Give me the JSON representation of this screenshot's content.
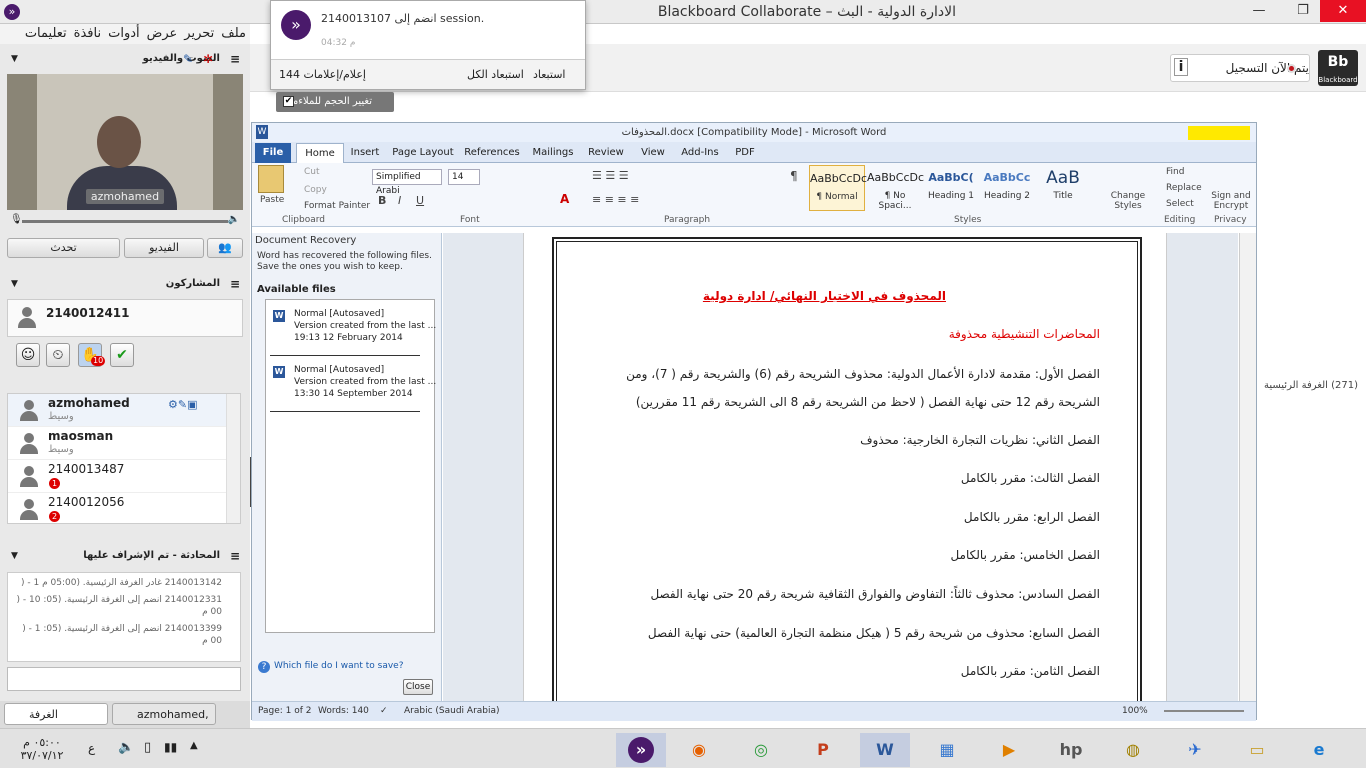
{
  "window": {
    "title": "Blackboard Collaborate – الادارة الدولية - البث",
    "icon": "bb-app-icon"
  },
  "menu": [
    "ملف",
    "تحرير",
    "عرض",
    "أدوات",
    "نافذة",
    "تعليمات"
  ],
  "collab": {
    "recording_label": "يتم الآن التسجيل",
    "logo_text": "Bb",
    "logo_sub": "Blackboard"
  },
  "notification": {
    "message": "2140013107 انضم إلى session.",
    "time": "04:32 م",
    "count_label": "144 إعلام/إعلامات",
    "dismiss_all": "استبعاد الكل",
    "dismiss": "استبعاد",
    "resize_option": "تغيير الحجم للملاءمة"
  },
  "left": {
    "av_title": "الصوت والفيديو",
    "video_name": "azmohamed",
    "talk_btn": "تحدث",
    "video_btn": "الفيديو",
    "participants_title": "المشاركون",
    "self_name": "2140012411",
    "raise_count": "10",
    "room_label": "(271) الغرفة الرئيسية",
    "participants": [
      {
        "name": "azmohamed",
        "role": "وسيط",
        "badge": ""
      },
      {
        "name": "maosman",
        "role": "وسيط",
        "badge": ""
      },
      {
        "name": "2140013487",
        "role": "",
        "badge": "1"
      },
      {
        "name": "2140012056",
        "role": "",
        "badge": "2"
      }
    ],
    "chat_title": "المحادثة - تم الإشراف عليها",
    "chat_lines": [
      "2140013142 غادر الغرفة الرئيسية. (05:00 م 1 - ( ",
      "2140012331 انضم إلى الغرفة الرئيسية. (05: 10 - ( 00 م",
      "2140013399 انضم إلى الغرفة الرئيسية. (05: 1 - ( 00 م"
    ],
    "tab_room": "الغرفة",
    "tab_user": "azmohamed, ..."
  },
  "word": {
    "title": "المحذوفات.docx [Compatibility Mode] - Microsoft Word",
    "tabs": [
      "File",
      "Home",
      "Insert",
      "Page Layout",
      "References",
      "Mailings",
      "Review",
      "View",
      "Add-Ins",
      "PDF"
    ],
    "clipboard": {
      "paste": "Paste",
      "cut": "Cut",
      "copy": "Copy",
      "format_painter": "Format Painter",
      "label": "Clipboard"
    },
    "font": {
      "name": "Simplified Arabi",
      "size": "14",
      "label": "Font"
    },
    "paragraph_label": "Paragraph",
    "styles": [
      {
        "sample": "AaBbCcDc",
        "name": "¶ Normal"
      },
      {
        "sample": "AaBbCcDc",
        "name": "¶ No Spaci..."
      },
      {
        "sample": "AaBbC(",
        "name": "Heading 1"
      },
      {
        "sample": "AaBbCc",
        "name": "Heading 2"
      },
      {
        "sample": "AaB",
        "name": "Title"
      }
    ],
    "change_styles": "Change Styles",
    "styles_label": "Styles",
    "editing": {
      "find": "Find",
      "replace": "Replace",
      "select": "Select",
      "label": "Editing"
    },
    "privacy": {
      "sign": "Sign and Encrypt",
      "label": "Privacy"
    },
    "recovery": {
      "title": "Document Recovery",
      "desc": "Word has recovered the following files.  Save the ones you wish to keep.",
      "available": "Available files",
      "items": [
        {
          "name": "Normal  [Autosaved]",
          "line2": "Version created from the last ...",
          "line3": "19:13 12 February 2014"
        },
        {
          "name": "Normal  [Autosaved]",
          "line2": "Version created from the last ...",
          "line3": "13:30 14 September 2014"
        }
      ],
      "which": "Which file do I want to save?",
      "close": "Close"
    },
    "doc": {
      "heading": "المحذوف في الاختبار النهائي/ ادارة دولية",
      "sub": "المحاضرات التنشيطية محذوفة",
      "lines": [
        "الفصل الأول: مقدمة لادارة الأعمال الدولية: محذوف الشريحة رقم (6) والشريحة رقم ( 7)، ومن",
        "الشريحة رقم 12 حتى نهاية الفصل ( لاحظ من الشريحة رقم 8 الى الشريحة رقم 11 مقررين)",
        "الفصل الثاني: نظريات التجارة الخارجية: محذوف",
        "الفصل الثالث: مقرر بالكامل",
        "الفصل الرابع: مقرر بالكامل",
        "الفصل الخامس: مقرر بالكامل",
        "الفصل السادس: محذوف ثالثاً: التفاوض والفوارق الثقافية شريحة رقم 20 حتى نهاية الفصل",
        "الفصل السابع: محذوف من شريحة رقم 5 ( هيكل منظمة التجارة العالمية) حتى نهاية الفصل",
        "الفصل الثامن: مقرر بالكامل"
      ]
    },
    "status": {
      "page": "Page: 1 of 2",
      "words": "Words: 140",
      "lang": "Arabic (Saudi Arabia)",
      "zoom": "100%"
    }
  },
  "taskbar": {
    "time": "٠٥:٠٠ م",
    "date": "٣٧/٠٧/١٢",
    "lang": "ع"
  }
}
